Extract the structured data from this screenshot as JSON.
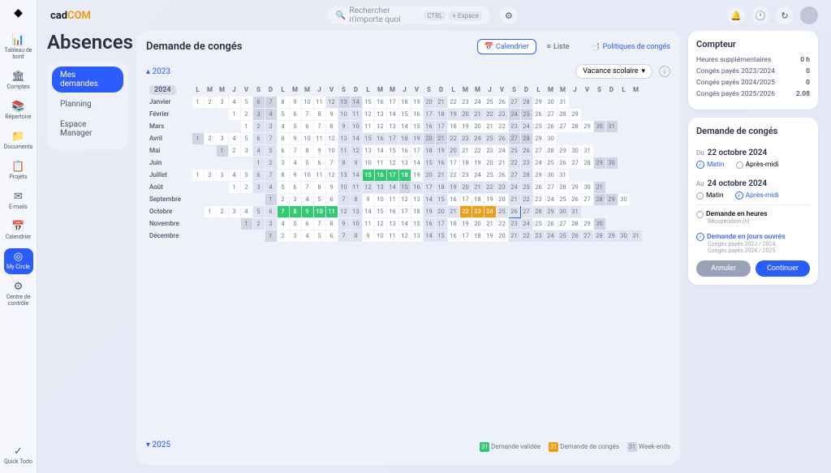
{
  "brand": {
    "p1": "cad",
    "p2": "COM"
  },
  "sidenav": [
    {
      "icon": "📊",
      "label": "Tableau de bord"
    },
    {
      "icon": "🏛",
      "label": "Comptes"
    },
    {
      "icon": "📚",
      "label": "Répertoire"
    },
    {
      "icon": "📁",
      "label": "Documents"
    },
    {
      "icon": "📋",
      "label": "Projets"
    },
    {
      "icon": "✉",
      "label": "E-mails"
    },
    {
      "icon": "📅",
      "label": "Calendrier"
    },
    {
      "icon": "◎",
      "label": "My Circle",
      "active": true
    },
    {
      "icon": "⚙",
      "label": "Centre de contrôle"
    }
  ],
  "quicktodo": {
    "icon": "✓",
    "label": "Quick Todo"
  },
  "search": {
    "placeholder": "Rechercher n'importe quoi",
    "kbd1": "CTRL",
    "kbd2": "+ Espace"
  },
  "pageTitle": "Absences",
  "tabs": [
    {
      "label": "Mes demandes",
      "active": true
    },
    {
      "label": "Planning"
    },
    {
      "label": "Espace Manager"
    }
  ],
  "center": {
    "title": "Demande de congés",
    "calBtn": "Calendrier",
    "listBtn": "Liste",
    "policies": "Politiques de congés",
    "y2023": "2023",
    "y2024": "2024",
    "y2025": "2025",
    "filter": "Vacance scolaire",
    "weekdays": [
      "L",
      "M",
      "M",
      "J",
      "V",
      "S",
      "D"
    ],
    "today": {
      "month": 9,
      "day": 26
    },
    "months": [
      {
        "name": "Janvier",
        "start": 0,
        "days": 31,
        "strong": [
          [
            12,
            14
          ],
          [
            20,
            21
          ],
          [
            27,
            28
          ]
        ],
        "we2": [
          [
            6,
            7
          ],
          [
            13,
            14
          ]
        ]
      },
      {
        "name": "Février",
        "start": 3,
        "days": 29,
        "strong": [
          [
            10,
            11
          ],
          [
            17,
            25
          ]
        ],
        "we2": [
          [
            3,
            4
          ],
          [
            24,
            25
          ]
        ]
      },
      {
        "name": "Mars",
        "start": 4,
        "days": 31,
        "strong": [
          [
            2,
            3
          ],
          [
            9,
            10
          ],
          [
            16,
            17
          ],
          [
            23,
            24
          ]
        ],
        "we2": [
          [
            30,
            31
          ]
        ]
      },
      {
        "name": "Avril",
        "start": 0,
        "days": 30,
        "strong": [
          [
            6,
            7
          ],
          [
            13,
            28
          ]
        ],
        "we2": [
          [
            1,
            1
          ],
          [
            20,
            21
          ],
          [
            27,
            28
          ]
        ]
      },
      {
        "name": "Mai",
        "start": 2,
        "days": 31,
        "strong": [
          [
            4,
            5
          ],
          [
            11,
            12
          ],
          [
            18,
            20
          ],
          [
            25,
            26
          ]
        ],
        "we2": [
          [
            1,
            1
          ]
        ]
      },
      {
        "name": "Juin",
        "start": 5,
        "days": 30,
        "strong": [
          [
            1,
            2
          ],
          [
            8,
            9
          ],
          [
            15,
            16
          ],
          [
            22,
            23
          ]
        ],
        "we2": [
          [
            29,
            30
          ]
        ]
      },
      {
        "name": "Juillet",
        "start": 0,
        "days": 31,
        "vac": [
          [
            15,
            18
          ]
        ],
        "strong": [
          [
            6,
            7
          ],
          [
            13,
            14
          ],
          [
            20,
            21
          ],
          [
            27,
            28
          ]
        ],
        "we2": []
      },
      {
        "name": "Août",
        "start": 3,
        "days": 31,
        "strong": [
          [
            3,
            4
          ],
          [
            10,
            25
          ]
        ],
        "we2": [
          [
            15,
            15
          ],
          [
            31,
            31
          ]
        ]
      },
      {
        "name": "Septembre",
        "start": 6,
        "days": 30,
        "strong": [
          [
            7,
            8
          ],
          [
            14,
            15
          ],
          [
            21,
            22
          ]
        ],
        "we2": [
          [
            1,
            1
          ],
          [
            28,
            29
          ]
        ]
      },
      {
        "name": "Octobre",
        "start": 1,
        "days": 31,
        "vac": [
          [
            7,
            11
          ]
        ],
        "req": [
          [
            22,
            24
          ]
        ],
        "strong": [
          [
            5,
            6
          ],
          [
            12,
            13
          ],
          [
            19,
            31
          ]
        ],
        "we2": []
      },
      {
        "name": "Novembre",
        "start": 4,
        "days": 30,
        "strong": [
          [
            2,
            3
          ],
          [
            9,
            10
          ],
          [
            16,
            17
          ],
          [
            23,
            24
          ]
        ],
        "we2": [
          [
            1,
            1
          ],
          [
            30,
            30
          ]
        ]
      },
      {
        "name": "Décembre",
        "start": 6,
        "days": 31,
        "strong": [
          [
            7,
            8
          ],
          [
            14,
            15
          ],
          [
            21,
            31
          ]
        ],
        "we2": [
          [
            1,
            1
          ]
        ]
      }
    ],
    "legend": [
      {
        "label": "Demande validée",
        "color": "#2ecc71",
        "txt": "31"
      },
      {
        "label": "Demande de congés",
        "color": "#f39c12",
        "txt": "31"
      },
      {
        "label": "Week-ends",
        "color": "#d0d5e4",
        "txt": "31",
        "txtc": "#6a7290"
      }
    ]
  },
  "counter": {
    "title": "Compteur",
    "rows": [
      {
        "label": "Heures supplémentaires",
        "val": "0 h"
      },
      {
        "label": "Congés payés 2023/2024",
        "val": "0"
      },
      {
        "label": "Congés payés 2024/2025",
        "val": "0"
      },
      {
        "label": "Congés payés 2025/2026",
        "val": "2.08"
      }
    ]
  },
  "request": {
    "title": "Demande de congés",
    "fromLabel": "Du",
    "fromDate": "22 octobre 2024",
    "toLabel": "Au",
    "toDate": "24 octobre 2024",
    "morning": "Matin",
    "afternoon": "Après-midi",
    "hoursTitle": "Demande en heures",
    "hoursSub": "Récupération (h)",
    "daysTitle": "Demande en jours ouvrés",
    "daysSub1": "Congés payés 2023 / 2024,",
    "daysSub2": "Congés payés 2024 / 2025",
    "cancel": "Annuler",
    "cont": "Continuer"
  }
}
